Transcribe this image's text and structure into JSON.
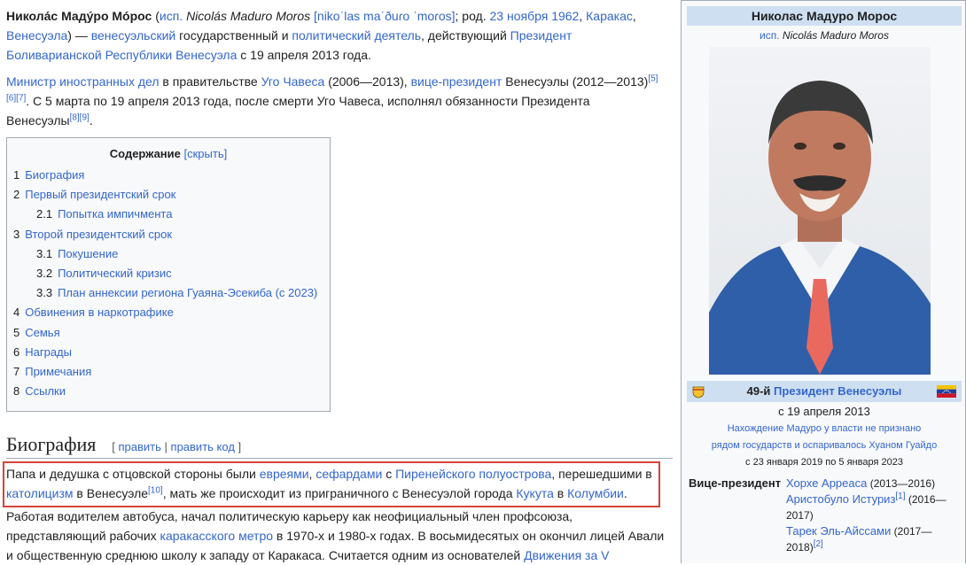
{
  "lead": {
    "name": "Никола́с Мадýро Мóрос",
    "lang_prefix": "исп.",
    "latin_name": "Nicolás Maduro Moros",
    "ipa": "[nikoˈlas maˈðuɾo ˈmoɾos]",
    "born_prefix": "; род.",
    "birth_date": "23 ноября 1962",
    "birth_city": "Каракас",
    "birth_country": "Венесуэла",
    "t1": ") —",
    "nationality": "венесуэльский",
    "t2": "государственный и",
    "political": "политический деятель",
    "t3": ", действующий",
    "president_link": "Президент Боливарианской Республики Венесуэла",
    "t4": "с 19 апреля 2013 года."
  },
  "para2": {
    "foreign_minister": "Министр иностранных дел",
    "t1": "в правительстве",
    "chavez": "Уго Чавеса",
    "t2": "(2006—2013),",
    "vice": "вице-президент",
    "t3": "Венесуэлы (2012—2013)",
    "refs1": "[5][6][7]",
    "t4": ". С 5 марта по 19 апреля 2013 года, после смерти Уго Чавеса, исполнял обязанности Президента Венесуэлы",
    "refs2": "[8][9]",
    "t5": "."
  },
  "toc": {
    "title": "Содержание",
    "toggle": "[скрыть]",
    "items": [
      {
        "num": "1",
        "label": "Биография"
      },
      {
        "num": "2",
        "label": "Первый президентский срок"
      },
      {
        "num": "2.1",
        "label": "Попытка импичмента"
      },
      {
        "num": "3",
        "label": "Второй президентский срок"
      },
      {
        "num": "3.1",
        "label": "Покушение"
      },
      {
        "num": "3.2",
        "label": "Политический кризис"
      },
      {
        "num": "3.3",
        "label": "План аннексии региона Гуаяна-Эсекиба (с 2023)"
      },
      {
        "num": "4",
        "label": "Обвинения в наркотрафике"
      },
      {
        "num": "5",
        "label": "Семья"
      },
      {
        "num": "6",
        "label": "Награды"
      },
      {
        "num": "7",
        "label": "Примечания"
      },
      {
        "num": "8",
        "label": "Ссылки"
      }
    ]
  },
  "section": {
    "title": "Биография",
    "edit": "править",
    "edit_code": "править код",
    "open_bracket": "[",
    "sep": "|",
    "close_bracket": "]"
  },
  "bio1": {
    "t1": "Папа и дедушка с отцовской стороны были",
    "jews": "евреями",
    "sep1": ",",
    "sephardi": "сефардами",
    "t2": "с",
    "iberian": "Пиренейского полуострова",
    "t3": ", перешедшими в",
    "catholic": "католицизм",
    "t4": "в Венесуэле",
    "ref": "[10]",
    "t5": ", мать же происходит из приграничного с Венесуэлой города",
    "cucuta": "Кукута",
    "t6": "в",
    "colombia": "Колумбии",
    "t7": "."
  },
  "bio2": {
    "t1": "Работая водителем автобуса, начал политическую карьеру как неофициальный член профсоюза, представляющий рабочих",
    "metro": "каракасского метро",
    "t2": "в 1970-х и 1980-х годах. В восьмидесятых он окончил лицей Авали и общественную среднюю школу к западу от Каракаса. Считается одним из основателей",
    "movement": "Движения за V"
  },
  "infobox": {
    "name": "Николас Мадуро Морос",
    "lang_prefix": "исп.",
    "latin_name": "Nicolás Maduro Moros",
    "office_prefix": "49-й",
    "office": "Президент Венесуэлы",
    "since": "с 19 апреля 2013",
    "note1": "Нахождение Мадуро у власти не признано",
    "note2": "рядом государств и оспаривалось Хуаном Гуайдо",
    "note3": "с 23 января 2019 по 5 января 2023",
    "vp_label": "Вице-президент",
    "vps": [
      {
        "name": "Хорхе Арреаса",
        "years": "(2013—2016)",
        "ref": ""
      },
      {
        "name": "Аристобуло Истуриз",
        "years": "(2016—2017)",
        "ref": "[1]"
      },
      {
        "name": "Тарек Эль-Айссами",
        "years": "(2017—2018)",
        "ref": "[2]"
      }
    ]
  },
  "colors": {
    "link": "#3366cc",
    "highlight_border": "#d7433a",
    "infobox_header": "#cedff2"
  }
}
